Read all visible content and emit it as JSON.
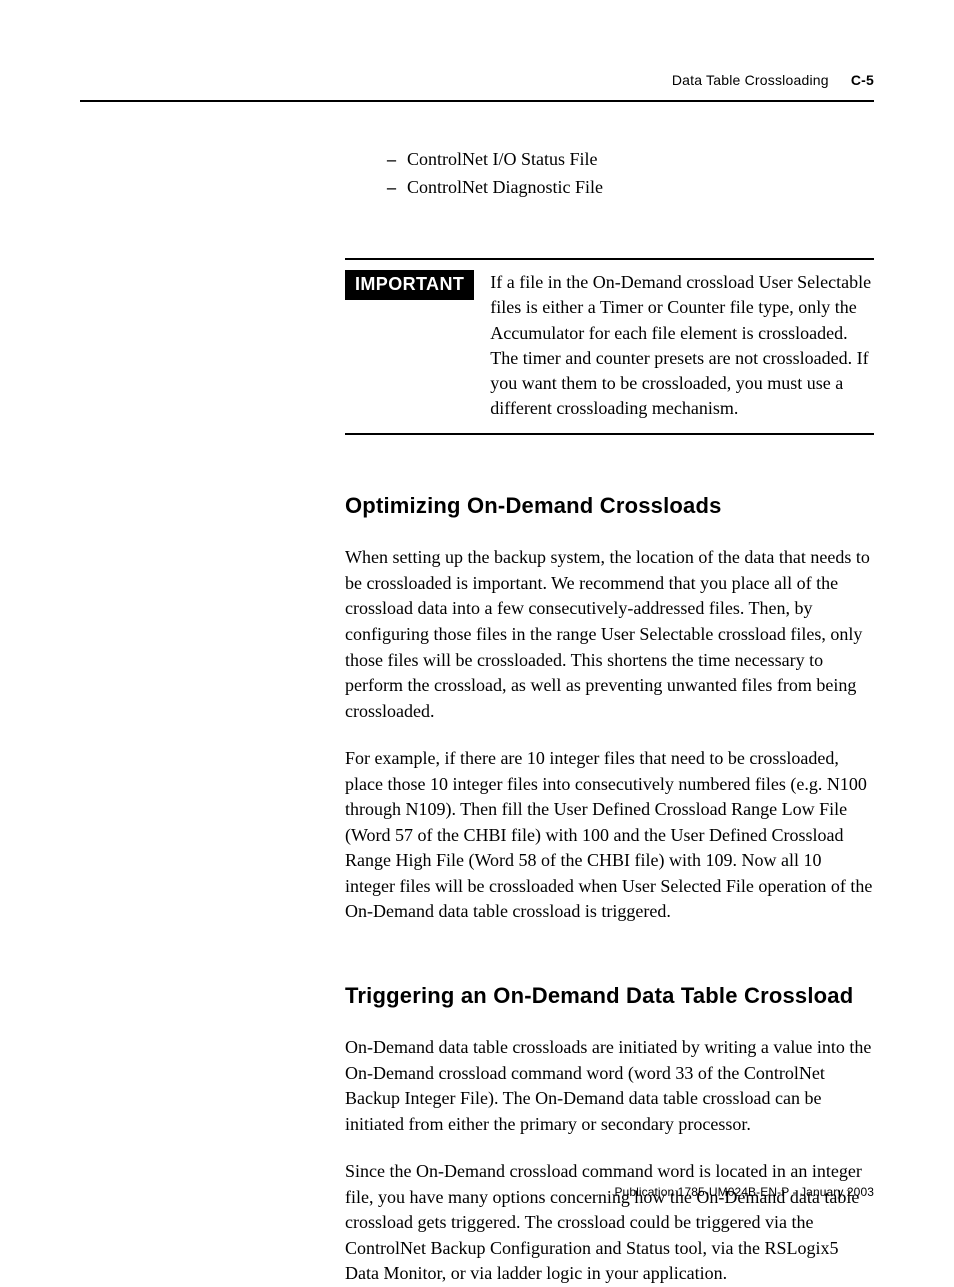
{
  "header": {
    "section_title": "Data Table Crossloading",
    "page_number": "C-5"
  },
  "bullets": {
    "items": [
      "ControlNet I/O Status File",
      "ControlNet Diagnostic File"
    ]
  },
  "callout": {
    "label": "IMPORTANT",
    "text": "If a file in the On-Demand crossload User Selectable files is either a Timer or Counter file type, only the Accumulator for each file element is crossloaded. The timer and counter presets are not crossloaded. If you want them to be crossloaded, you must use a different crossloading mechanism."
  },
  "sections": [
    {
      "heading": "Optimizing On-Demand Crossloads",
      "paragraphs": [
        "When setting up the backup system, the location of the data that needs to be crossloaded is important. We recommend that you place all of the crossload data into a few consecutively-addressed files. Then, by configuring those files in the range User Selectable crossload files, only those files will be crossloaded. This shortens the time necessary to perform the crossload, as well as preventing unwanted files from being crossloaded.",
        "For example, if there are 10 integer files that need to be crossloaded, place those 10 integer files into consecutively numbered files (e.g. N100 through N109). Then fill the User Defined Crossload Range Low File (Word 57 of the CHBI file) with 100 and the User Defined Crossload Range High File (Word 58 of the CHBI file) with 109. Now all 10 integer files will be crossloaded when User Selected File operation of the On-Demand data table crossload is triggered."
      ]
    },
    {
      "heading": "Triggering an On-Demand Data Table Crossload",
      "paragraphs": [
        "On-Demand data table crossloads are initiated by writing a value into the On-Demand crossload command word (word 33 of the ControlNet Backup Integer File). The On-Demand data table crossload can be initiated from either the primary or secondary processor.",
        "Since the On-Demand crossload command word is located in an integer file, you have many options concerning how the On-Demand data table crossload gets triggered. The crossload could be triggered via the ControlNet Backup Configuration and Status tool, via the RSLogix5 Data Monitor, or via ladder logic in your application."
      ]
    }
  ],
  "footer": {
    "text": "Publication 1785-UM024B-EN-P - January 2003"
  }
}
